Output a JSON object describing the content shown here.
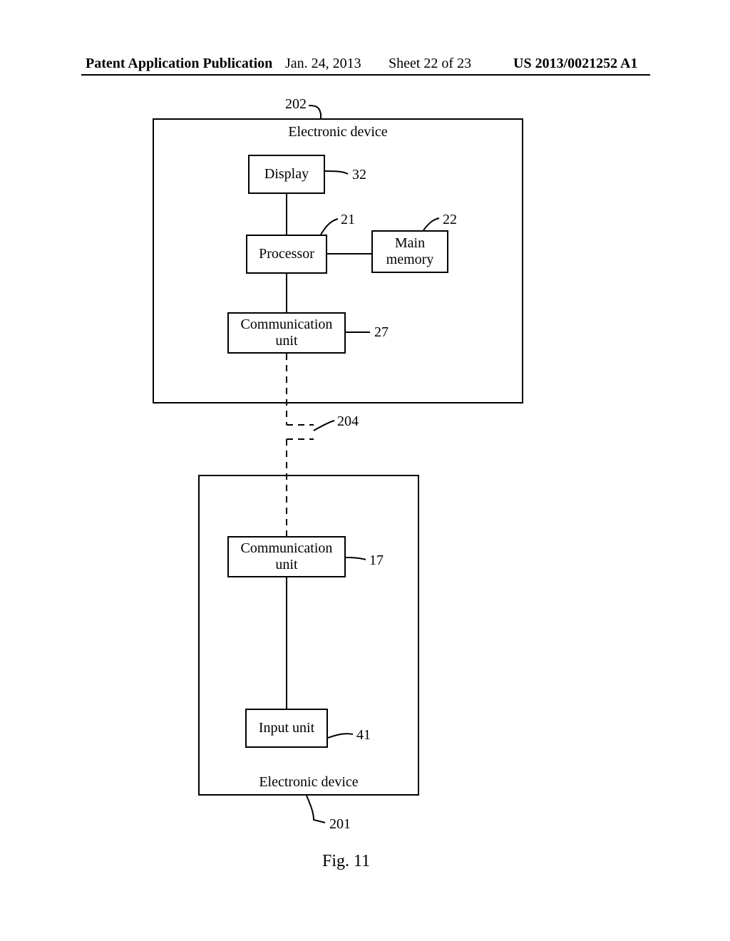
{
  "header": {
    "left": "Patent Application Publication",
    "date": "Jan. 24, 2013",
    "sheet": "Sheet 22 of 23",
    "pubno": "US 2013/0021252 A1"
  },
  "device_top": {
    "ref": "202",
    "title": "Electronic device",
    "display": {
      "label": "Display",
      "ref": "32"
    },
    "processor": {
      "label": "Processor",
      "ref": "21"
    },
    "memory": {
      "label": "Main\nmemory",
      "ref": "22"
    },
    "comm": {
      "label": "Communication\nunit",
      "ref": "27"
    }
  },
  "link": {
    "ref": "204"
  },
  "device_bottom": {
    "ref": "201",
    "title": "Electronic device",
    "comm": {
      "label": "Communication\nunit",
      "ref": "17"
    },
    "input": {
      "label": "Input unit",
      "ref": "41"
    }
  },
  "figure": {
    "caption": "Fig. 11"
  }
}
